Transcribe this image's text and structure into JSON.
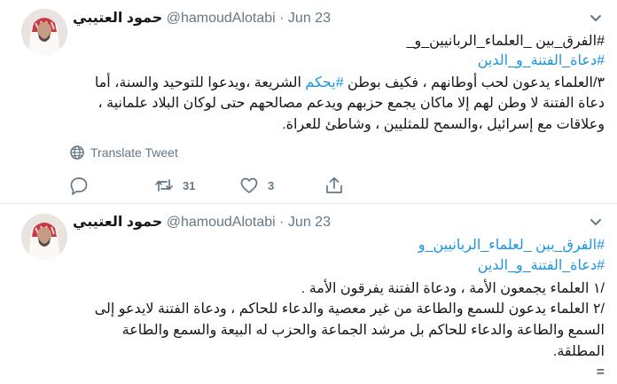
{
  "tweets": [
    {
      "author": {
        "name": "حمود العتيبي",
        "handle": "@hamoudAlotabi",
        "date": "Jun 23"
      },
      "separator": "·",
      "hashtags": [
        "#الفرق_بين _العلماء_الربانيين_و_",
        "#دعاة_الفتنة_و_الدين"
      ],
      "body_lines": [
        {
          "pre": "٣/العلماء يدعون لحب أوطانهم ، فكيف بوطن ",
          "tag": "#يحكم",
          "post": " الشريعة ،ويدعوا للتوحيد والسنة، أما"
        },
        {
          "text": "دعاة الفتنة لا وطن لهم إلا ماكان يجمع حزبهم ويدعم مصالحهم حتى لوكان البلاد علمانية ،"
        },
        {
          "text": "وعلاقات مع إسرائيل ،والسمح للمثليين ، وشاطئ للعراة."
        }
      ],
      "translate_label": "Translate Tweet",
      "counts": {
        "replies": "",
        "retweets": "31",
        "likes": "3"
      }
    },
    {
      "author": {
        "name": "حمود العتيبي",
        "handle": "@hamoudAlotabi",
        "date": "Jun 23"
      },
      "separator": "·",
      "hashtags": [
        "#الفرق_بين _لعلماء_الربانيين_و",
        "#دعاة_الفتنة_و_الدين"
      ],
      "body_lines": [
        {
          "text": "/١ العلماء يجمعون الأمة ، ودعاة الفتنة يفرقون الأمة ."
        },
        {
          "text": "/٢ العلماء يدعون للسمع والطاعة من غير معصية والدعاء للحاكم ، ودعاة الفتنة لايدعو إلى"
        },
        {
          "text": "السمع والطاعة والدعاء  للحاكم بل مرشد الجماعة والحزب له البيعة والسمع والطاعة"
        },
        {
          "text": "المطلقة."
        },
        {
          "text": "="
        }
      ]
    }
  ]
}
